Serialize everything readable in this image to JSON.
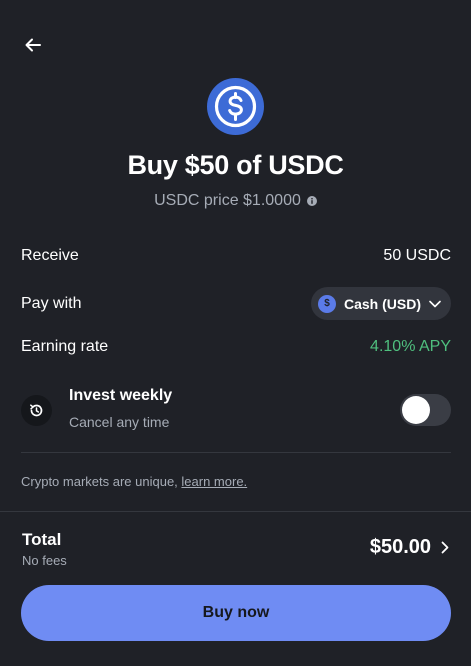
{
  "header": {
    "back_icon": "arrow-left-icon",
    "coin_icon": "usdc-coin-icon",
    "title": "Buy $50 of USDC",
    "price_text": "USDC price $1.0000",
    "info_icon": "info-icon"
  },
  "details": {
    "receive_label": "Receive",
    "receive_value": "50 USDC",
    "pay_with_label": "Pay with",
    "pay_with_value": "Cash (USD)",
    "pay_with_icon": "usd-coin-icon",
    "earning_rate_label": "Earning rate",
    "earning_rate_value": "4.10% APY"
  },
  "invest": {
    "icon": "recurring-clock-icon",
    "title": "Invest weekly",
    "subtitle": "Cancel any time",
    "enabled": false
  },
  "disclaimer": {
    "text": "Crypto markets are unique, ",
    "link": "learn more."
  },
  "footer": {
    "total_label": "Total",
    "fees_text": "No fees",
    "total_amount": "$50.00",
    "buy_label": "Buy now"
  },
  "colors": {
    "background": "#1f2127",
    "accent": "#6f8cf3",
    "usdc_blue": "#3d6bd6",
    "apy_green": "#4fbf7e",
    "muted_text": "#a6acb6"
  }
}
